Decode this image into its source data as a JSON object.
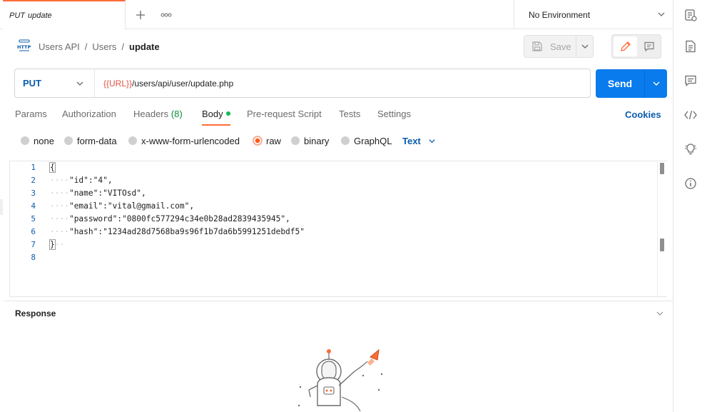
{
  "tab": {
    "method": "PUT",
    "name": "update"
  },
  "environment": {
    "label": "No Environment"
  },
  "breadcrumb": {
    "collection": "Users API",
    "folder": "Users",
    "current": "update",
    "separator": "/"
  },
  "toolbar": {
    "save_label": "Save"
  },
  "request": {
    "method": "PUT",
    "url_var": "{{URL}}",
    "url_path": "/users/api/user/update.php",
    "send_label": "Send"
  },
  "subtabs": [
    {
      "label": "Params"
    },
    {
      "label": "Authorization"
    },
    {
      "label": "Headers",
      "count": "(8)"
    },
    {
      "label": "Body",
      "active": true
    },
    {
      "label": "Pre-request Script"
    },
    {
      "label": "Tests"
    },
    {
      "label": "Settings"
    }
  ],
  "cookies_label": "Cookies",
  "body_types": [
    {
      "label": "none"
    },
    {
      "label": "form-data"
    },
    {
      "label": "x-www-form-urlencoded"
    },
    {
      "label": "raw",
      "selected": true
    },
    {
      "label": "binary"
    },
    {
      "label": "GraphQL"
    }
  ],
  "raw_format": "Text",
  "editor": {
    "line_numbers": [
      "1",
      "2",
      "3",
      "4",
      "5",
      "6",
      "7",
      "8"
    ],
    "lines": [
      {
        "indent": "",
        "text": "{"
      },
      {
        "indent": "····",
        "text": "\"id\":\"4\","
      },
      {
        "indent": "····",
        "text": "\"name\":\"VITOsd\","
      },
      {
        "indent": "····",
        "text": "\"email\":\"vital@gmail.com\","
      },
      {
        "indent": "····",
        "text": "\"password\":\"0800fc577294c34e0b28ad2839435945\","
      },
      {
        "indent": "····",
        "text": "\"hash\":\"1234ad28d7568ba9s96f1b7da6b5991251debdf5\""
      },
      {
        "indent": "",
        "text": "}",
        "trail": "··"
      },
      {
        "indent": "",
        "text": ""
      }
    ]
  },
  "response": {
    "title": "Response"
  },
  "icons": {
    "tab_add": "plus-icon",
    "tab_more": "more-icon",
    "env": "chevron-down-icon",
    "http": "http-icon",
    "save": "save-icon",
    "edit": "pencil-icon",
    "comment": "comment-icon",
    "rail": [
      "environment-icon",
      "documentation-icon",
      "comments-icon",
      "code-icon",
      "bulb-icon",
      "info-icon"
    ]
  },
  "colors": {
    "accent": "#ff6c37",
    "send": "#097bed",
    "link": "#0b5cad",
    "variable": "#e05243"
  }
}
